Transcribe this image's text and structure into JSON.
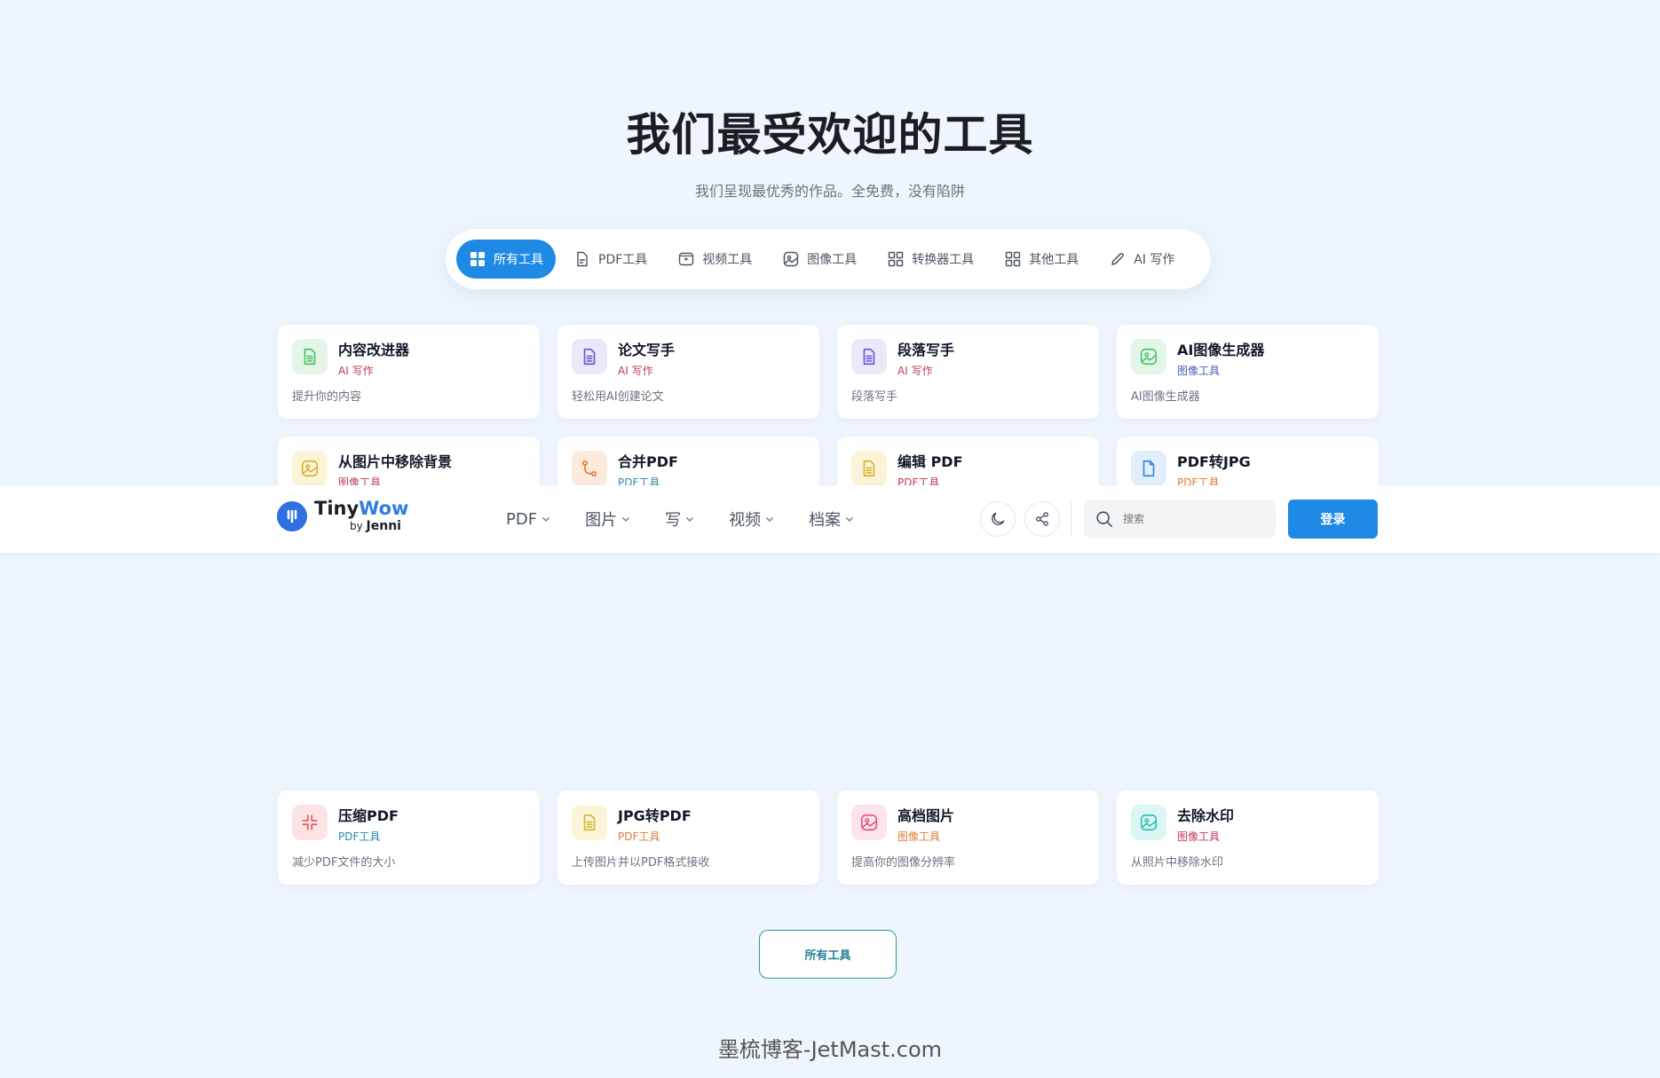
{
  "hero": {
    "title": "我们最受欢迎的工具",
    "subtitle": "我们呈现最优秀的作品。全免费，没有陷阱"
  },
  "tabs": [
    {
      "label": "所有工具",
      "icon": "grid-icon",
      "active": true
    },
    {
      "label": "PDF工具",
      "icon": "pdf-file-icon"
    },
    {
      "label": "视频工具",
      "icon": "video-icon"
    },
    {
      "label": "图像工具",
      "icon": "image-icon"
    },
    {
      "label": "转换器工具",
      "icon": "grid-outline-icon"
    },
    {
      "label": "其他工具",
      "icon": "grid-outline-icon"
    },
    {
      "label": "AI 写作",
      "icon": "pencil-icon"
    }
  ],
  "cards": [
    {
      "title": "内容改进器",
      "category": "AI 写作",
      "category_color": "#c0395a",
      "desc": "提升你的内容",
      "icon": "document-icon",
      "icon_color": "#4cc26b",
      "icon_bg": "#e3f6e8"
    },
    {
      "title": "论文写手",
      "category": "AI 写作",
      "category_color": "#c0395a",
      "desc": "轻松用AI创建论文",
      "icon": "document-icon",
      "icon_color": "#6b5bd6",
      "icon_bg": "#ebe8fa"
    },
    {
      "title": "段落写手",
      "category": "AI 写作",
      "category_color": "#c0395a",
      "desc": "段落写手",
      "icon": "document-icon",
      "icon_color": "#6b5bd6",
      "icon_bg": "#ebe8fa"
    },
    {
      "title": "AI图像生成器",
      "category": "图像工具",
      "category_color": "#4b5bb8",
      "desc": "AI图像生成器",
      "icon": "image-icon",
      "icon_color": "#4cc26b",
      "icon_bg": "#e3f6e8"
    },
    {
      "title": "从图片中移除背景",
      "category": "图像工具",
      "category_color": "#c0395a",
      "desc": "",
      "icon": "image-icon",
      "icon_color": "#d9b532",
      "icon_bg": "#fbf4d8"
    },
    {
      "title": "合并PDF",
      "category": "PDF工具",
      "category_color": "#2a8aa8",
      "desc": "",
      "icon": "merge-icon",
      "icon_color": "#e07a3a",
      "icon_bg": "#fdeadd"
    },
    {
      "title": "编辑 PDF",
      "category": "PDF工具",
      "category_color": "#c0395a",
      "desc": "",
      "icon": "document-icon",
      "icon_color": "#d9b532",
      "icon_bg": "#fbf4d8"
    },
    {
      "title": "PDF转JPG",
      "category": "PDF工具",
      "category_color": "#e07a3a",
      "desc": "",
      "icon": "file-icon",
      "icon_color": "#3a86d9",
      "icon_bg": "#e1eefb"
    },
    {
      "title": "压缩PDF",
      "category": "PDF工具",
      "category_color": "#2a8aa8",
      "desc": "减少PDF文件的大小",
      "icon": "compress-icon",
      "icon_color": "#e05a5a",
      "icon_bg": "#fde3e3"
    },
    {
      "title": "JPG转PDF",
      "category": "PDF工具",
      "category_color": "#e07a3a",
      "desc": "上传图片并以PDF格式接收",
      "icon": "document-icon",
      "icon_color": "#d9b532",
      "icon_bg": "#fbf4d8"
    },
    {
      "title": "高档图片",
      "category": "图像工具",
      "category_color": "#e07a3a",
      "desc": "提高你的图像分辨率",
      "icon": "image-icon",
      "icon_color": "#e0557a",
      "icon_bg": "#fde3ea"
    },
    {
      "title": "去除水印",
      "category": "图像工具",
      "category_color": "#c0395a",
      "desc": "从照片中移除水印",
      "icon": "image-icon",
      "icon_color": "#2cc0b0",
      "icon_bg": "#dcf6f3"
    }
  ],
  "navbar": {
    "logo_text_1": "Tiny",
    "logo_text_2": "Wow",
    "logo_by": "by",
    "logo_jenni": "Jenni",
    "menu": [
      "PDF",
      "图片",
      "写",
      "视频",
      "档案"
    ],
    "search_placeholder": "搜索",
    "login_label": "登录"
  },
  "all_tools_label": "所有工具",
  "watermark": "墨梳博客-JetMast.com"
}
